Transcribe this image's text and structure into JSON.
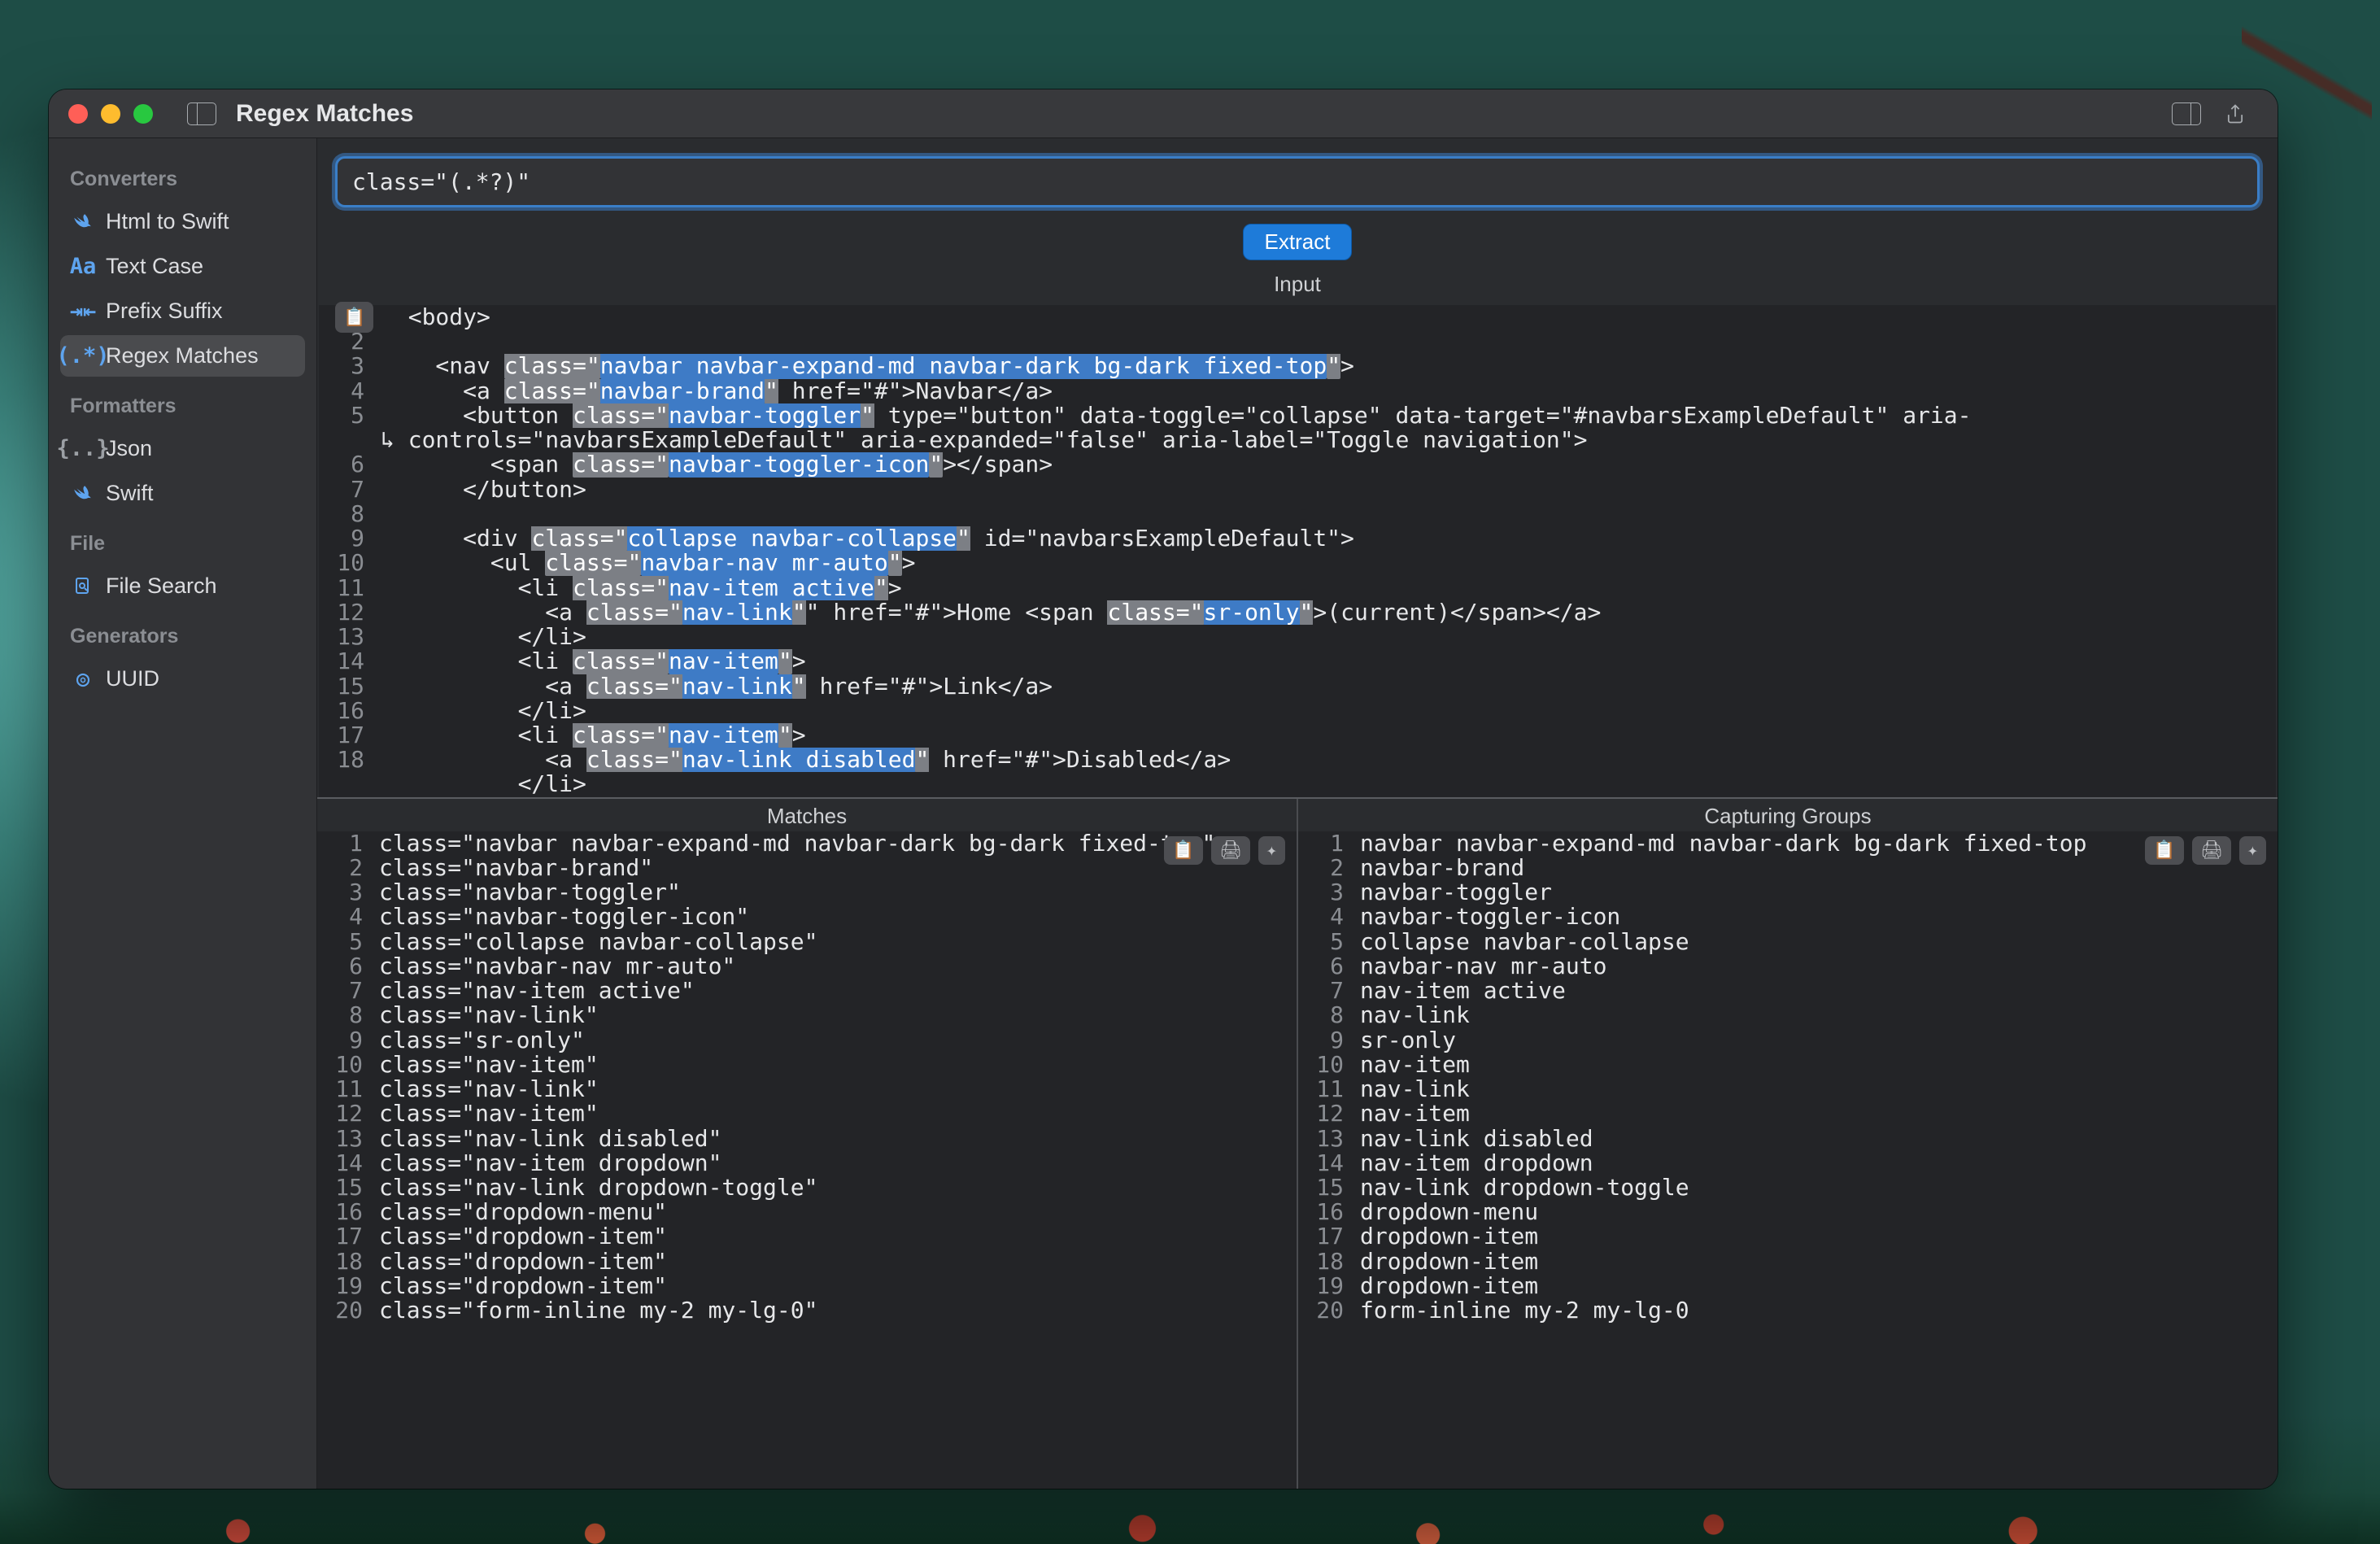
{
  "window": {
    "title": "Regex Matches"
  },
  "sidebar": {
    "groups": [
      {
        "label": "Converters",
        "items": [
          {
            "label": "Html to Swift",
            "icon": "swift",
            "icon_color": "blue"
          },
          {
            "label": "Text Case",
            "icon": "Aa",
            "icon_color": "blue"
          },
          {
            "label": "Prefix Suffix",
            "icon": "arrows",
            "icon_color": "blue"
          },
          {
            "label": "Regex Matches",
            "icon": "regex",
            "icon_color": "blue",
            "selected": true
          }
        ]
      },
      {
        "label": "Formatters",
        "items": [
          {
            "label": "Json",
            "icon": "{..}",
            "icon_color": "grey"
          },
          {
            "label": "Swift",
            "icon": "swift",
            "icon_color": "blue"
          }
        ]
      },
      {
        "label": "File",
        "items": [
          {
            "label": "File Search",
            "icon": "doc-search",
            "icon_color": "blue"
          }
        ]
      },
      {
        "label": "Generators",
        "items": [
          {
            "label": "UUID",
            "icon": "target",
            "icon_color": "blue"
          }
        ]
      }
    ]
  },
  "regex": {
    "pattern": "class=\"(.*?)\""
  },
  "buttons": {
    "extract": "Extract"
  },
  "labels": {
    "input": "Input",
    "matches": "Matches",
    "capturing_groups": "Capturing Groups"
  },
  "input_code": [
    {
      "n": 1,
      "indent": 1,
      "pre": "<body>",
      "attr": null,
      "val": null,
      "post": null
    },
    {
      "n": 2,
      "indent": 0,
      "pre": "",
      "attr": null,
      "val": null,
      "post": null
    },
    {
      "n": 3,
      "indent": 2,
      "pre": "<nav ",
      "attr": "class=\"",
      "val": "navbar navbar-expand-md navbar-dark bg-dark fixed-top",
      "post": "\">"
    },
    {
      "n": 4,
      "indent": 3,
      "pre": "<a ",
      "attr": "class=\"",
      "val": "navbar-brand",
      "post": "\" href=\"#\">Navbar</a>"
    },
    {
      "n": 5,
      "indent": 3,
      "pre": "<button ",
      "attr": "class=\"",
      "val": "navbar-toggler",
      "post": "\" type=\"button\" data-toggle=\"collapse\" data-target=\"#navbarsExampleDefault\" aria-"
    },
    {
      "n": null,
      "indent": 0,
      "pre": "↳ controls=\"navbarsExampleDefault\" aria-expanded=\"false\" aria-label=\"Toggle navigation\">",
      "attr": null,
      "val": null,
      "post": null
    },
    {
      "n": 6,
      "indent": 4,
      "pre": "<span ",
      "attr": "class=\"",
      "val": "navbar-toggler-icon",
      "post": "\"></span>"
    },
    {
      "n": 7,
      "indent": 3,
      "pre": "</button>",
      "attr": null,
      "val": null,
      "post": null
    },
    {
      "n": 8,
      "indent": 0,
      "pre": "",
      "attr": null,
      "val": null,
      "post": null
    },
    {
      "n": 9,
      "indent": 3,
      "pre": "<div ",
      "attr": "class=\"",
      "val": "collapse navbar-collapse",
      "post": "\" id=\"navbarsExampleDefault\">"
    },
    {
      "n": 10,
      "indent": 4,
      "pre": "<ul ",
      "attr": "class=\"",
      "val": "navbar-nav mr-auto",
      "post": "\">"
    },
    {
      "n": 11,
      "indent": 5,
      "pre": "<li ",
      "attr": "class=\"",
      "val": "nav-item active",
      "post": "\">"
    },
    {
      "n": 12,
      "indent": 6,
      "pre": "<a ",
      "attr": "class=\"",
      "val": "nav-link",
      "post": "\" href=\"#\">Home <span ",
      "attr2": "class=\"",
      "val2": "sr-only",
      "post2": "\">(current)</span></a>"
    },
    {
      "n": 13,
      "indent": 5,
      "pre": "</li>",
      "attr": null,
      "val": null,
      "post": null
    },
    {
      "n": 14,
      "indent": 5,
      "pre": "<li ",
      "attr": "class=\"",
      "val": "nav-item",
      "post": "\">"
    },
    {
      "n": 15,
      "indent": 6,
      "pre": "<a ",
      "attr": "class=\"",
      "val": "nav-link",
      "post": "\" href=\"#\">Link</a>"
    },
    {
      "n": 16,
      "indent": 5,
      "pre": "</li>",
      "attr": null,
      "val": null,
      "post": null
    },
    {
      "n": 17,
      "indent": 5,
      "pre": "<li ",
      "attr": "class=\"",
      "val": "nav-item",
      "post": "\">"
    },
    {
      "n": 18,
      "indent": 6,
      "pre": "<a ",
      "attr": "class=\"",
      "val": "nav-link disabled",
      "post": "\" href=\"#\">Disabled</a>"
    },
    {
      "n": null,
      "indent": 5,
      "pre": "</li>",
      "attr": null,
      "val": null,
      "post": null
    }
  ],
  "matches": [
    "class=\"navbar navbar-expand-md navbar-dark bg-dark fixed-top\"",
    "class=\"navbar-brand\"",
    "class=\"navbar-toggler\"",
    "class=\"navbar-toggler-icon\"",
    "class=\"collapse navbar-collapse\"",
    "class=\"navbar-nav mr-auto\"",
    "class=\"nav-item active\"",
    "class=\"nav-link\"",
    "class=\"sr-only\"",
    "class=\"nav-item\"",
    "class=\"nav-link\"",
    "class=\"nav-item\"",
    "class=\"nav-link disabled\"",
    "class=\"nav-item dropdown\"",
    "class=\"nav-link dropdown-toggle\"",
    "class=\"dropdown-menu\"",
    "class=\"dropdown-item\"",
    "class=\"dropdown-item\"",
    "class=\"dropdown-item\"",
    "class=\"form-inline my-2 my-lg-0\""
  ],
  "groups": [
    "navbar navbar-expand-md navbar-dark bg-dark fixed-top",
    "navbar-brand",
    "navbar-toggler",
    "navbar-toggler-icon",
    "collapse navbar-collapse",
    "navbar-nav mr-auto",
    "nav-item active",
    "nav-link",
    "sr-only",
    "nav-item",
    "nav-link",
    "nav-item",
    "nav-link disabled",
    "nav-item dropdown",
    "nav-link dropdown-toggle",
    "dropdown-menu",
    "dropdown-item",
    "dropdown-item",
    "dropdown-item",
    "form-inline my-2 my-lg-0"
  ]
}
